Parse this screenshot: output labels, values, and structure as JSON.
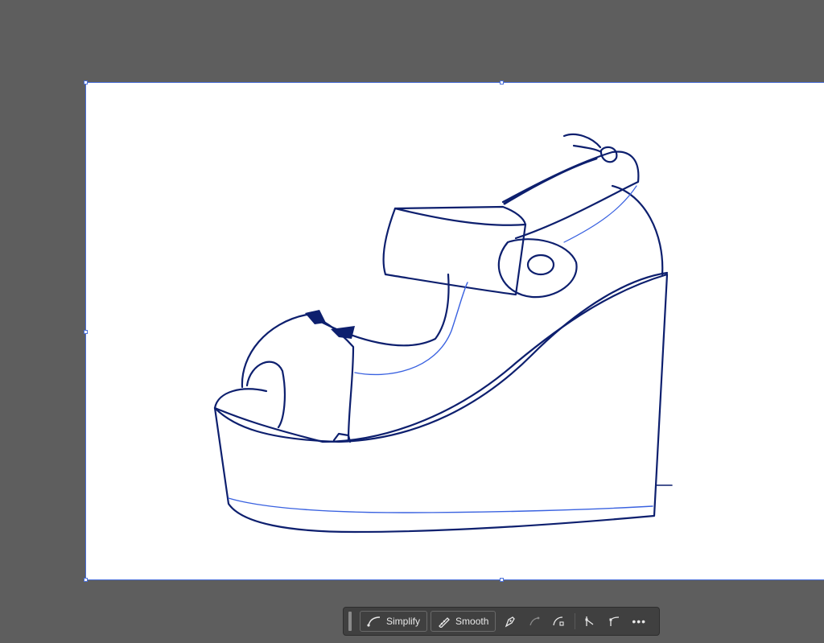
{
  "toolbar": {
    "simplify_label": "Simplify",
    "smooth_label": "Smooth",
    "more_label": "•••"
  },
  "colors": {
    "canvas_bg": "#5e5e5e",
    "artboard_bg": "#ffffff",
    "selection": "#4a6fd8",
    "stroke": "#0d1f6e",
    "toolbar_bg": "#404040"
  }
}
